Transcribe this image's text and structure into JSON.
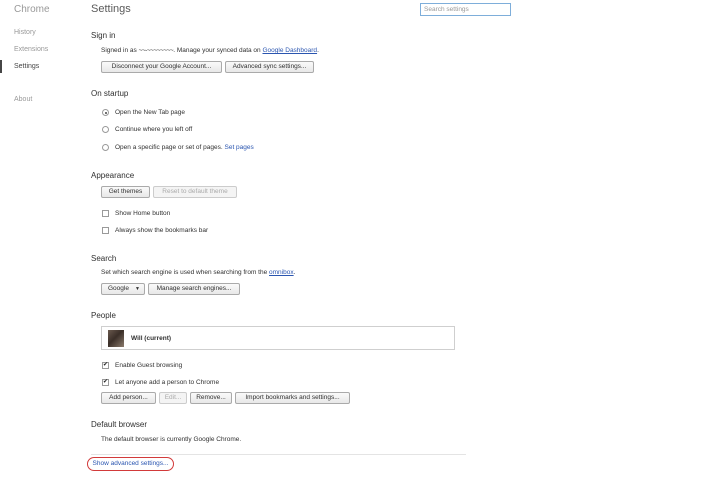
{
  "sidebar": {
    "brand": "Chrome",
    "items": [
      "History",
      "Extensions",
      "Settings",
      "About"
    ]
  },
  "header": {
    "title": "Settings",
    "search_placeholder": "Search settings"
  },
  "signin": {
    "heading": "Sign in",
    "text_prefix": "Signed in as",
    "account_redacted": "~~-~~~~~~~~",
    "text_mid": ". Manage your synced data on",
    "dashboard_link": "Google Dashboard",
    "text_end": ".",
    "disconnect_button": "Disconnect your Google Account...",
    "advanced_sync_button": "Advanced sync settings..."
  },
  "startup": {
    "heading": "On startup",
    "option1": "Open the New Tab page",
    "option2": "Continue where you left off",
    "option3": "Open a specific page or set of pages.",
    "set_pages_link": "Set pages"
  },
  "appearance": {
    "heading": "Appearance",
    "get_themes_button": "Get themes",
    "reset_theme_button": "Reset to default theme",
    "show_home": "Show Home button",
    "bookmarks_bar": "Always show the bookmarks bar"
  },
  "search": {
    "heading": "Search",
    "desc_prefix": "Set which search engine is used when searching from the",
    "omnibox_link": "omnibox",
    "desc_end": ".",
    "engine_value": "Google",
    "manage_button": "Manage search engines..."
  },
  "people": {
    "heading": "People",
    "current_user": "Will (current)",
    "guest_browsing": "Enable Guest browsing",
    "anyone_add": "Let anyone add a person to Chrome",
    "add_button": "Add person...",
    "edit_button": "Edit...",
    "remove_button": "Remove...",
    "import_button": "Import bookmarks and settings..."
  },
  "default_browser": {
    "heading": "Default browser",
    "text": "The default browser is currently Google Chrome."
  },
  "footer": {
    "advanced_link": "Show advanced settings..."
  },
  "checkmark": "✔",
  "dropdown_arrow": "▼"
}
